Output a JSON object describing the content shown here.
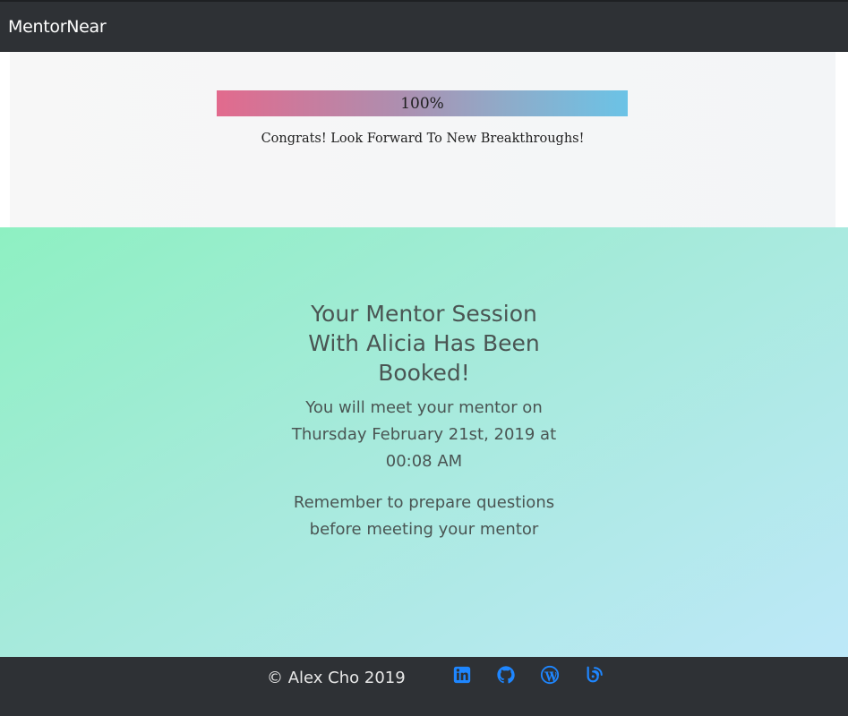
{
  "navbar": {
    "brand": "MentorNear"
  },
  "progress": {
    "percent": 100,
    "label": "100%",
    "message": "Congrats! Look Forward To New Breakthroughs!"
  },
  "booking": {
    "title": "Your Mentor Session With Alicia Has Been Booked!",
    "date_line": "You will meet your mentor on Thursday February 21st, 2019 at 00:08 AM",
    "reminder": "Remember to prepare questions before meeting your mentor"
  },
  "footer": {
    "copyright": "© Alex Cho 2019",
    "links": [
      {
        "icon": "linkedin-icon"
      },
      {
        "icon": "github-icon"
      },
      {
        "icon": "wordpress-icon"
      },
      {
        "icon": "blog-icon"
      }
    ],
    "link_color": "#1e86ff"
  },
  "colors": {
    "navbar_bg": "#2e3135",
    "progress_start": "#e26a8d",
    "progress_end": "#6bc3e6",
    "booking_gradient_start": "#8ef0c2",
    "booking_gradient_end": "#bde8f8"
  }
}
